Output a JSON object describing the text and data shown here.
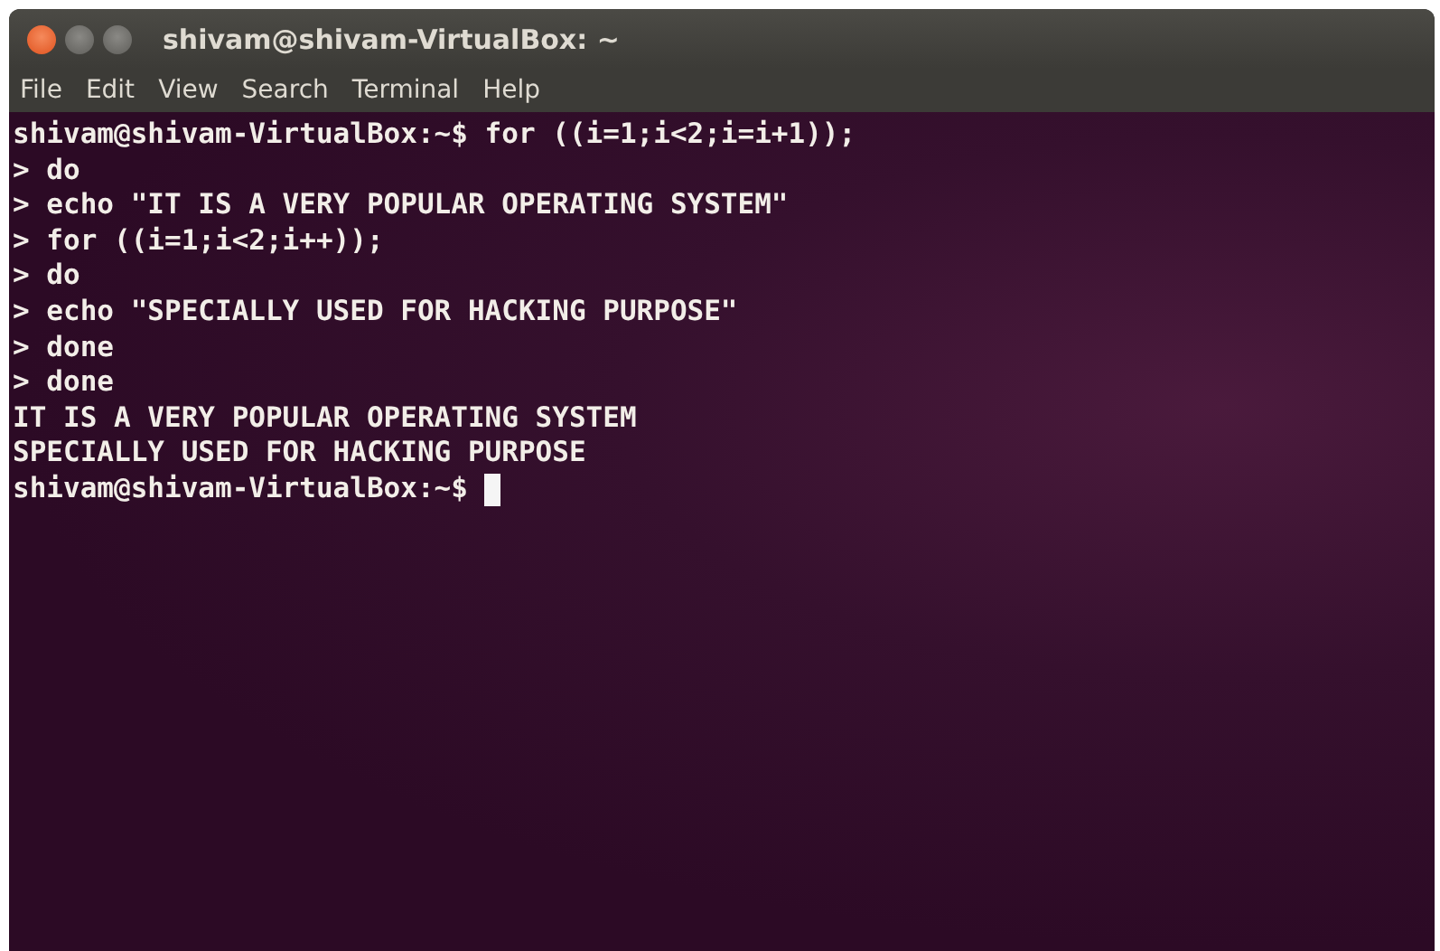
{
  "window": {
    "title": "shivam@shivam-VirtualBox: ~"
  },
  "menu": [
    "File",
    "Edit",
    "View",
    "Search",
    "Terminal",
    "Help"
  ],
  "terminal": {
    "lines": [
      "shivam@shivam-VirtualBox:~$ for ((i=1;i<2;i=i+1));",
      "> do",
      "> echo \"IT IS A VERY POPULAR OPERATING SYSTEM\"",
      "> for ((i=1;i<2;i++));",
      "> do",
      "> echo \"SPECIALLY USED FOR HACKING PURPOSE\"",
      "> done",
      "> done",
      "IT IS A VERY POPULAR OPERATING SYSTEM",
      "SPECIALLY USED FOR HACKING PURPOSE"
    ],
    "prompt": "shivam@shivam-VirtualBox:~$"
  }
}
